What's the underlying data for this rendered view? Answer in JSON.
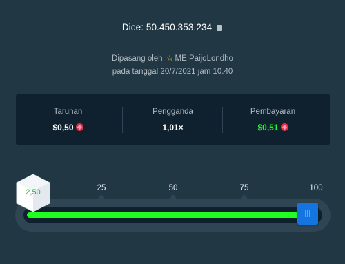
{
  "bet_info": {
    "title": "Dice: 50.450.353.234",
    "placed_by_prefix": "Dipasang oleh",
    "username": "ME PaijoLondho",
    "placed_on": "pada tanggal 20/7/2021 jam 10.40"
  },
  "stats": {
    "wager": {
      "label": "Taruhan",
      "value": "$0,50",
      "currency_icon": "ruby-coin-icon"
    },
    "multiplier": {
      "label": "Pengganda",
      "value": "1,01×"
    },
    "payout": {
      "label": "Pembayaran",
      "value": "$0,51",
      "currency_icon": "ruby-coin-icon"
    }
  },
  "slider": {
    "ticks": [
      "25",
      "50",
      "75",
      "100"
    ],
    "roll_result": "2,50",
    "target_value": 98,
    "fill_color": "#1fff20",
    "handle_color": "#1475e1"
  },
  "colors": {
    "background": "#213743",
    "panel": "#0f212e",
    "win_green": "#1fff20",
    "star": "#f5c518"
  }
}
